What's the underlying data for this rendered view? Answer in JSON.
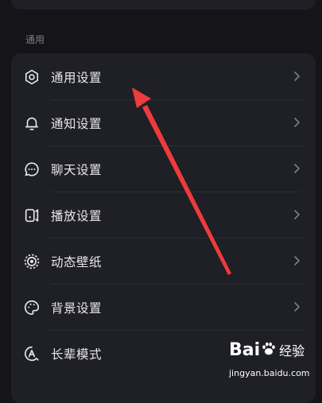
{
  "section": {
    "title": "通用"
  },
  "items": [
    {
      "label": "通用设置",
      "icon": "gear-icon"
    },
    {
      "label": "通知设置",
      "icon": "bell-icon"
    },
    {
      "label": "聊天设置",
      "icon": "chat-bubble-icon"
    },
    {
      "label": "播放设置",
      "icon": "play-device-icon"
    },
    {
      "label": "动态壁纸",
      "icon": "live-wallpaper-icon"
    },
    {
      "label": "背景设置",
      "icon": "palette-icon"
    },
    {
      "label": "长辈模式",
      "icon": "elder-mode-icon"
    }
  ],
  "watermark": {
    "brand_text": "Bai",
    "brand_suffix": "经验",
    "url": "jingyan.baidu.com"
  },
  "colors": {
    "background": "#141419",
    "card": "#1f1f26",
    "text": "#e6e6ea",
    "muted": "#7e7e86",
    "arrow": "#ee3b3b"
  }
}
